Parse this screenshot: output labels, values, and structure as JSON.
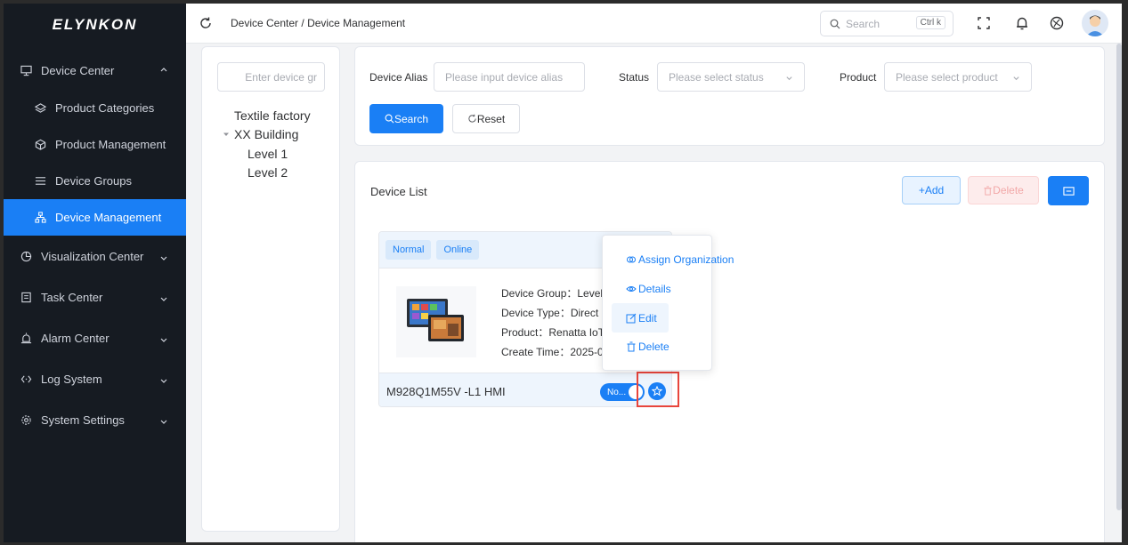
{
  "app": {
    "logo": "ELYNKON"
  },
  "sidebar": {
    "items": [
      {
        "label": "Device Center",
        "icon": "monitor-icon",
        "expanded": true
      },
      {
        "label": "Product Categories",
        "icon": "layers-icon"
      },
      {
        "label": "Product Management",
        "icon": "box-icon"
      },
      {
        "label": "Device Groups",
        "icon": "list-icon"
      },
      {
        "label": "Device Management",
        "icon": "org-tree-icon",
        "active": true
      },
      {
        "label": "Visualization Center",
        "icon": "chart-pie-icon"
      },
      {
        "label": "Task Center",
        "icon": "clipboard-icon"
      },
      {
        "label": "Alarm Center",
        "icon": "alarm-icon"
      },
      {
        "label": "Log System",
        "icon": "code-icon"
      },
      {
        "label": "System Settings",
        "icon": "gear-icon"
      }
    ]
  },
  "header": {
    "breadcrumb": [
      "Device Center",
      "/",
      "Device Management"
    ],
    "search_placeholder": "Search",
    "search_shortcut": "Ctrl k"
  },
  "tree": {
    "search_placeholder": "Enter device gr",
    "nodes": [
      "Textile factory",
      "XX Building",
      "Level 1",
      "Level 2"
    ]
  },
  "filters": {
    "alias_label": "Device Alias",
    "alias_placeholder": "Please input device alias",
    "status_label": "Status",
    "status_placeholder": "Please select status",
    "product_label": "Product",
    "product_placeholder": "Please select product",
    "search_button": "Search",
    "reset_button": "Reset"
  },
  "device_list": {
    "title": "Device List",
    "add_button": "+Add",
    "delete_button": "Delete"
  },
  "card": {
    "tags": [
      "Normal",
      "Online"
    ],
    "group": "Device Group：Level",
    "type": "Device Type：Direct I",
    "product": "Product：Renatta IoT",
    "create_time": "Create Time：2025-0",
    "name": "M928Q1M55V -L1 HMI",
    "toggle_text": "No..."
  },
  "menu": {
    "items": [
      "Assign Organization",
      "Details",
      "Edit",
      "Delete"
    ]
  },
  "colors": {
    "primary": "#1a7ff5",
    "sidebar_bg": "#161b22",
    "highlight": "#e8453c"
  }
}
